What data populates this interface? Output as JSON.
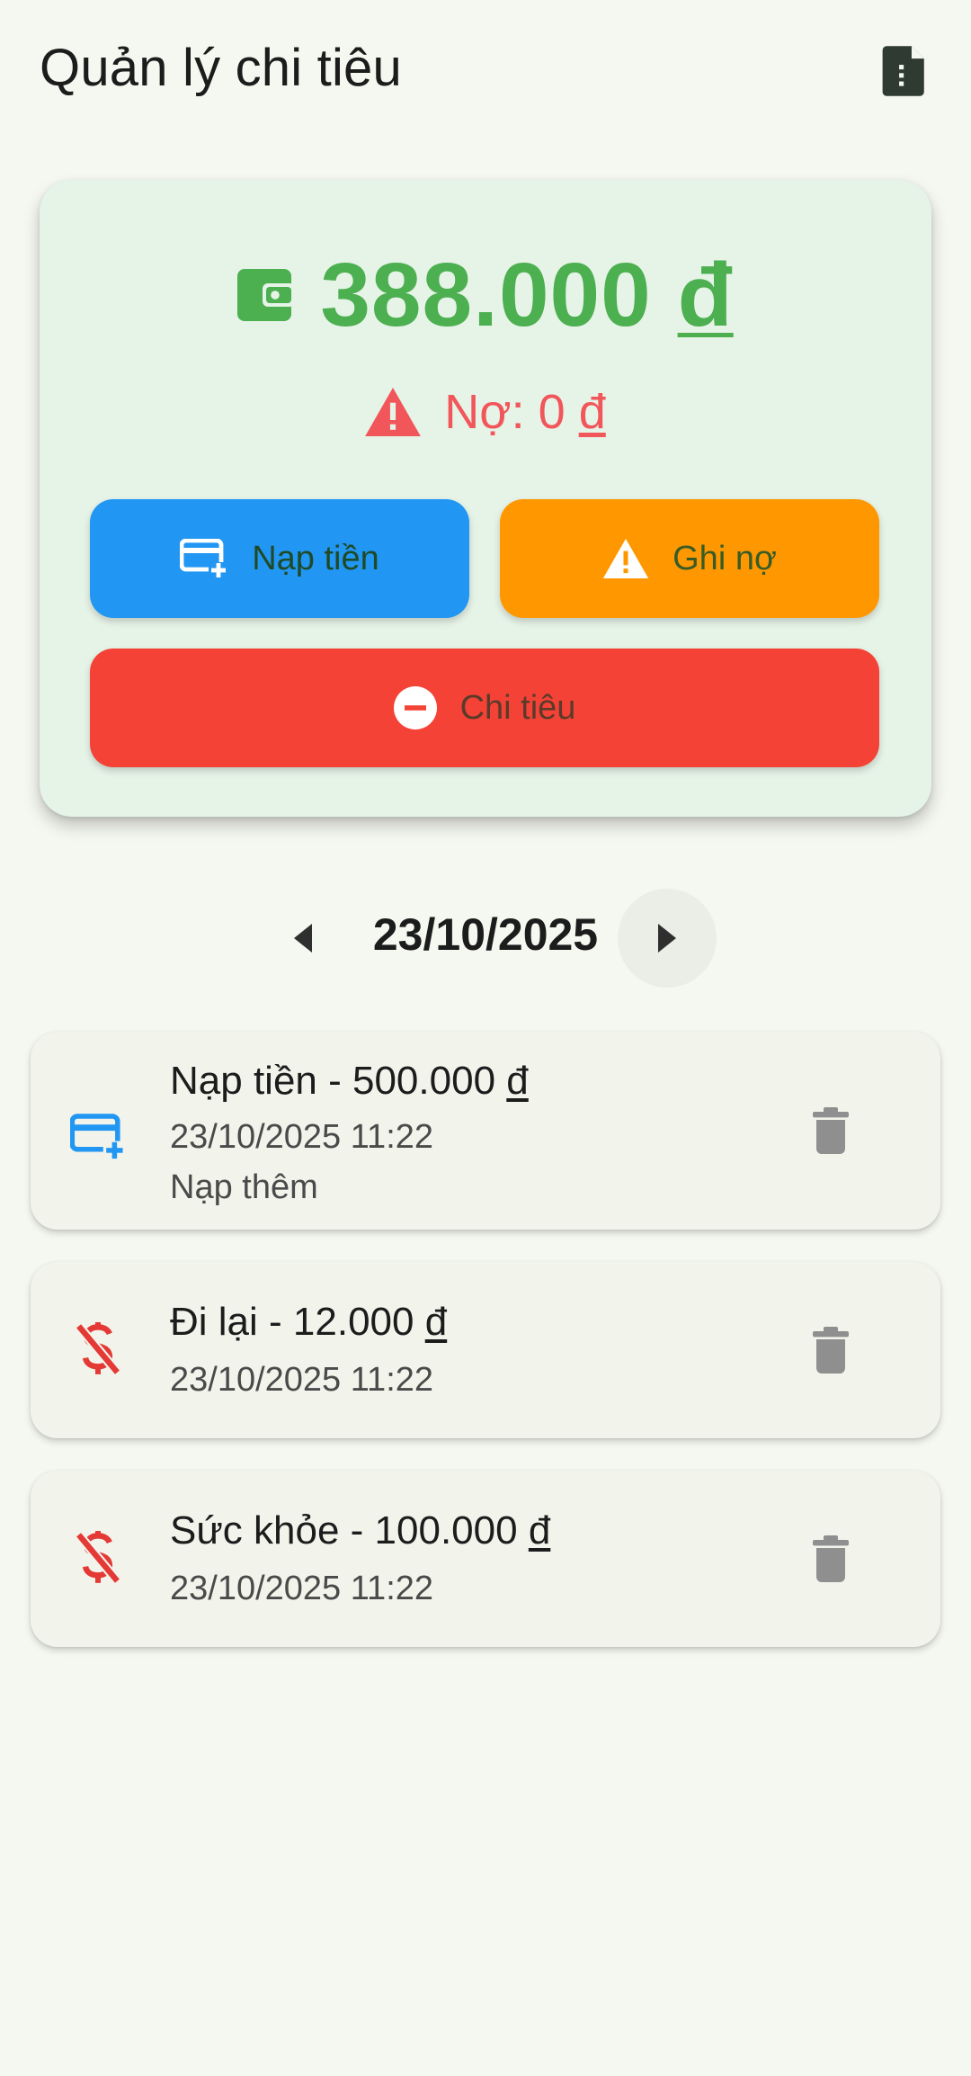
{
  "app": {
    "title": "Quản lý chi tiêu",
    "export_icon": "document-icon"
  },
  "summary": {
    "balance_number": "388.000",
    "balance_currency": "đ",
    "debt_label": "Nợ: 0",
    "debt_currency": "đ",
    "colors": {
      "balance": "#4caf50",
      "debt": "#f0565a"
    }
  },
  "actions": {
    "deposit_label": "Nạp tiền",
    "debt_label": "Ghi nợ",
    "spend_label": "Chi tiêu",
    "colors": {
      "deposit": "#2196f3",
      "debt": "#ff9800",
      "spend": "#f44336"
    }
  },
  "date_nav": {
    "date": "23/10/2025"
  },
  "transactions": [
    {
      "title": "Nạp tiền - 500.000",
      "currency": "đ",
      "time": "23/10/2025 11:22",
      "note": "Nạp thêm",
      "icon": "add-card-icon"
    },
    {
      "title": "Đi lại - 12.000",
      "currency": "đ",
      "time": "23/10/2025 11:22",
      "icon": "money-off-icon"
    },
    {
      "title": "Sức khỏe - 100.000",
      "currency": "đ",
      "time": "23/10/2025 11:22",
      "icon": "money-off-icon"
    }
  ]
}
